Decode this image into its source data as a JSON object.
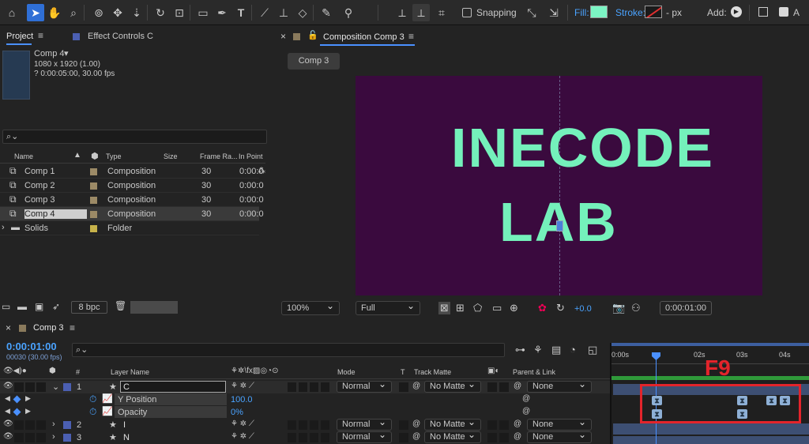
{
  "toolbar": {
    "snapping": "Snapping",
    "fill_label": "Fill:",
    "stroke_label": "Stroke:",
    "stroke_unit": "- px",
    "add_label": "Add:",
    "fill_color": "#7cf5c4"
  },
  "project": {
    "tab_project": "Project",
    "tab_effects": "Effect Controls C",
    "comp_name": "Comp 4",
    "comp_size": "1080 x 1920 (1.00)",
    "comp_duration": "? 0:00:05:00, 30.00 fps",
    "search_placeholder": "",
    "columns": {
      "name": "Name",
      "type": "Type",
      "size": "Size",
      "frame_rate": "Frame Ra...",
      "in_point": "In Point"
    },
    "items": [
      {
        "name": "Comp 1",
        "type": "Composition",
        "frame_rate": "30",
        "in_point": "0:00:0"
      },
      {
        "name": "Comp 2",
        "type": "Composition",
        "frame_rate": "30",
        "in_point": "0:00:0"
      },
      {
        "name": "Comp 3",
        "type": "Composition",
        "frame_rate": "30",
        "in_point": "0:00:0"
      },
      {
        "name": "Comp 4",
        "type": "Composition",
        "frame_rate": "30",
        "in_point": "0:00:0"
      },
      {
        "name": "Solids",
        "type": "Folder",
        "frame_rate": "",
        "in_point": ""
      }
    ],
    "bpc": "8 bpc"
  },
  "composition": {
    "tab_title": "Composition Comp 3",
    "comp_tab": "Comp 3",
    "text_line1": "INECODE",
    "text_line2": "LAB",
    "bg_color": "#3a0a3e",
    "text_color": "#74f1bb",
    "zoom": "100%",
    "resolution": "Full",
    "exposure": "+0.0",
    "timecode": "0:00:01:00"
  },
  "timeline": {
    "tab": "Comp 3",
    "timecode": "0:00:01:00",
    "frame_info": "00030 (30.00 fps)",
    "search_placeholder": "",
    "columns": {
      "num": "#",
      "layer_name": "Layer Name",
      "mode": "Mode",
      "t": "T",
      "track_matte": "Track Matte",
      "parent": "Parent & Link"
    },
    "ruler": [
      "0:00s",
      "02s",
      "03s",
      "04s"
    ],
    "overlay_label": "F9",
    "layers": [
      {
        "num": "1",
        "name": "C",
        "mode": "Normal",
        "matte": "No Matte",
        "parent": "None"
      },
      {
        "num": "2",
        "name": "I",
        "mode": "Normal",
        "matte": "No Matte",
        "parent": "None"
      },
      {
        "num": "3",
        "name": "N",
        "mode": "Normal",
        "matte": "No Matte",
        "parent": "None"
      }
    ],
    "props": [
      {
        "name": "Y Position",
        "value": "100.0"
      },
      {
        "name": "Opacity",
        "value": "0%"
      }
    ]
  }
}
